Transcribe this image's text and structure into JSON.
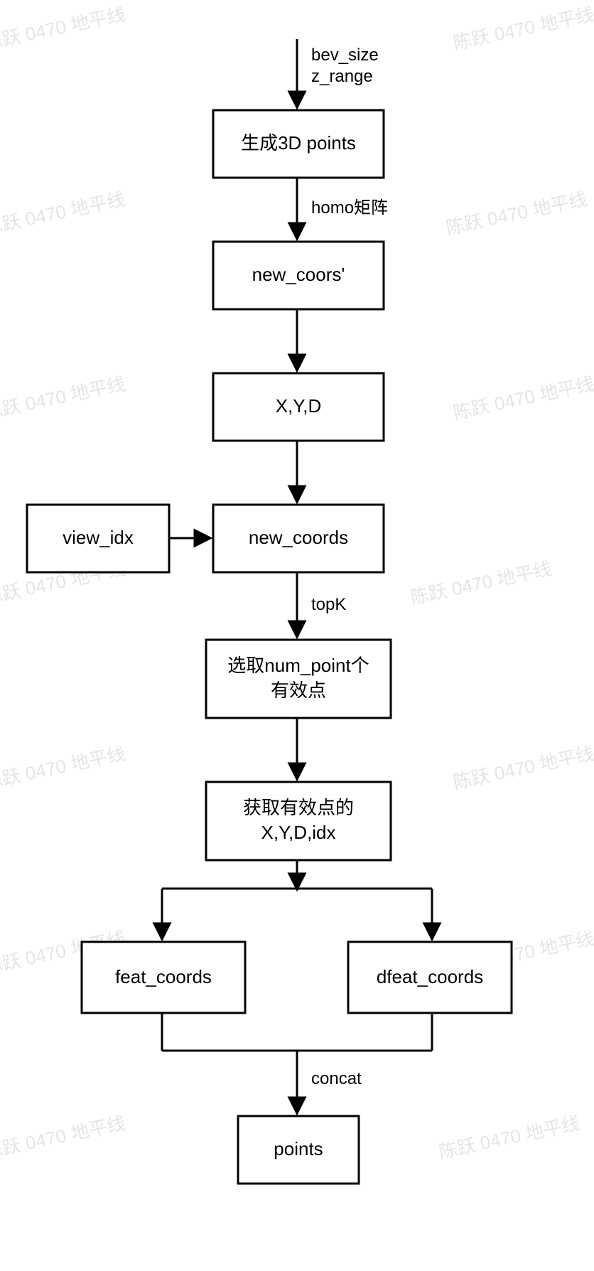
{
  "watermark": "陈跃 0470 地平线",
  "nodes": {
    "n1": "生成3D points",
    "n2": "new_coors'",
    "n3": "X,Y,D",
    "n4": "new_coords",
    "side": "view_idx",
    "n5_l1": "选取num_point个",
    "n5_l2": "有效点",
    "n6_l1": "获取有效点的",
    "n6_l2": "X,Y,D,idx",
    "n7a": "feat_coords",
    "n7b": "dfeat_coords",
    "n8": "points"
  },
  "edges": {
    "in_l1": "bev_size",
    "in_l2": "z_range",
    "e12": "homo矩阵",
    "e45": "topK",
    "e78": "concat"
  }
}
